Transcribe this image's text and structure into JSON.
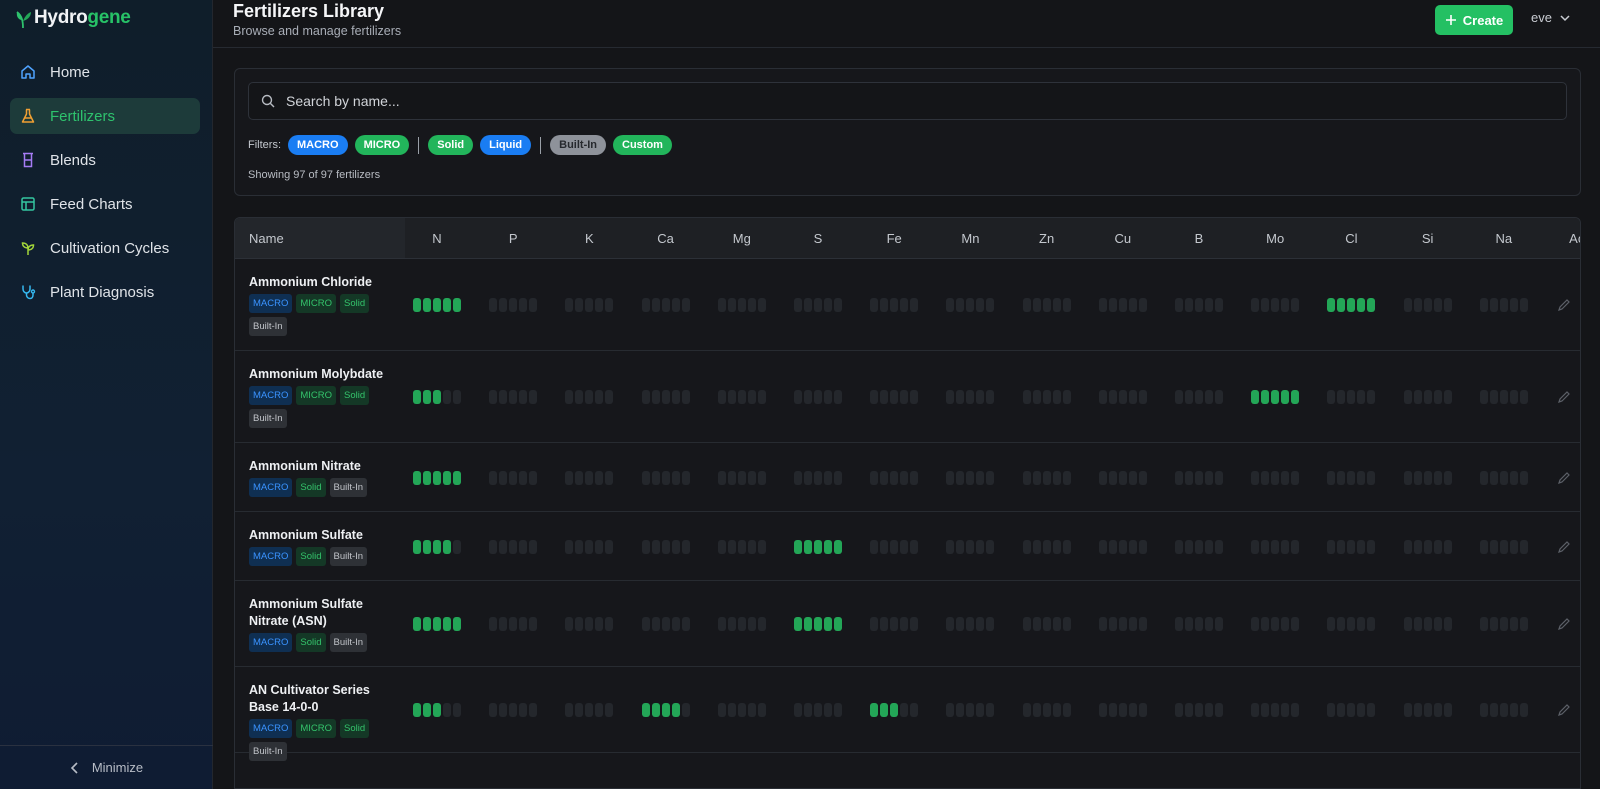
{
  "app": {
    "name_part1": "Hydro",
    "name_part2": "gene"
  },
  "sidebar": {
    "items": [
      {
        "label": "Home",
        "icon": "home-icon",
        "active": false
      },
      {
        "label": "Fertilizers",
        "icon": "flask-icon",
        "active": true
      },
      {
        "label": "Blends",
        "icon": "beaker-icon",
        "active": false
      },
      {
        "label": "Feed Charts",
        "icon": "table-icon",
        "active": false
      },
      {
        "label": "Cultivation Cycles",
        "icon": "sprout-icon",
        "active": false
      },
      {
        "label": "Plant Diagnosis",
        "icon": "stethoscope-icon",
        "active": false
      }
    ],
    "minimize_label": "Minimize"
  },
  "header": {
    "title": "Fertilizers Library",
    "subtitle": "Browse and manage fertilizers",
    "create_label": "Create",
    "user": "eve"
  },
  "search": {
    "placeholder": "Search by name...",
    "value": ""
  },
  "filters": {
    "label": "Filters:",
    "chips": [
      "MACRO",
      "MICRO",
      "Solid",
      "Liquid",
      "Built-In",
      "Custom"
    ],
    "showing": "Showing 97 of 97 fertilizers"
  },
  "table": {
    "headers": [
      "Name",
      "N",
      "P",
      "K",
      "Ca",
      "Mg",
      "S",
      "Fe",
      "Mn",
      "Zn",
      "Cu",
      "B",
      "Mo",
      "Cl",
      "Si",
      "Na",
      "Acti"
    ],
    "rows": [
      {
        "name": "Ammonium Chloride",
        "tags": [
          "MACRO",
          "MICRO",
          "Solid",
          "Built-In"
        ],
        "levels": [
          5,
          0,
          0,
          0,
          0,
          0,
          0,
          0,
          0,
          0,
          0,
          0,
          5,
          0,
          0
        ]
      },
      {
        "name": "Ammonium Molybdate",
        "tags": [
          "MACRO",
          "MICRO",
          "Solid",
          "Built-In"
        ],
        "levels": [
          3,
          0,
          0,
          0,
          0,
          0,
          0,
          0,
          0,
          0,
          0,
          5,
          0,
          0,
          0
        ]
      },
      {
        "name": "Ammonium Nitrate",
        "tags": [
          "MACRO",
          "Solid",
          "Built-In"
        ],
        "levels": [
          5,
          0,
          0,
          0,
          0,
          0,
          0,
          0,
          0,
          0,
          0,
          0,
          0,
          0,
          0
        ]
      },
      {
        "name": "Ammonium Sulfate",
        "tags": [
          "MACRO",
          "Solid",
          "Built-In"
        ],
        "levels": [
          4,
          0,
          0,
          0,
          0,
          5,
          0,
          0,
          0,
          0,
          0,
          0,
          0,
          0,
          0
        ]
      },
      {
        "name": "Ammonium Sulfate Nitrate (ASN)",
        "tags": [
          "MACRO",
          "Solid",
          "Built-In"
        ],
        "levels": [
          5,
          0,
          0,
          0,
          0,
          5,
          0,
          0,
          0,
          0,
          0,
          0,
          0,
          0,
          0
        ]
      },
      {
        "name": "AN Cultivator Series Base 14-0-0",
        "tags": [
          "MACRO",
          "MICRO",
          "Solid",
          "Built-In"
        ],
        "levels": [
          3,
          0,
          0,
          4,
          0,
          0,
          3,
          0,
          0,
          0,
          0,
          0,
          0,
          0,
          0
        ]
      }
    ]
  },
  "colors": {
    "accent": "#24c063",
    "macro": "#1a7df3",
    "bar_on": "#23a657",
    "bar_off": "#24272c"
  }
}
